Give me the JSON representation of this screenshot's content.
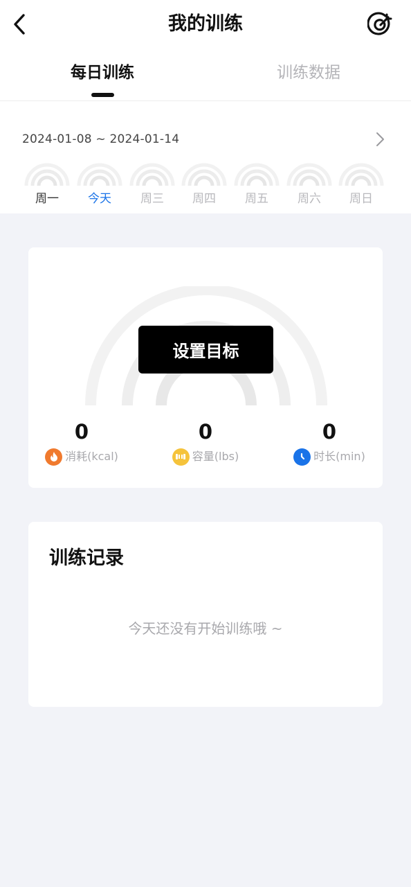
{
  "header": {
    "title": "我的训练",
    "back_icon": "chevron-left-icon",
    "target_icon": "target-icon"
  },
  "tabs": [
    {
      "label": "每日训练",
      "active": true
    },
    {
      "label": "训练数据",
      "active": false
    }
  ],
  "week": {
    "date_range": "2024-01-08 ~ 2024-01-14",
    "days": [
      "周一",
      "今天",
      "周三",
      "周四",
      "周五",
      "周六",
      "周日"
    ],
    "today_index": 1
  },
  "goal": {
    "button_label": "设置目标",
    "stats": [
      {
        "value": "0",
        "label": "消耗(kcal)",
        "icon": "flame-icon",
        "color": "#f07a2e"
      },
      {
        "value": "0",
        "label": "容量(lbs)",
        "icon": "dumbbell-icon",
        "color": "#f5c33b"
      },
      {
        "value": "0",
        "label": "时长(min)",
        "icon": "clock-icon",
        "color": "#1a73e8"
      }
    ]
  },
  "records": {
    "title": "训练记录",
    "empty_text": "今天还没有开始训练哦 ~"
  },
  "colors": {
    "accent": "#1a73e8",
    "background": "#f2f3f8",
    "ring": "#f0f0f0"
  }
}
